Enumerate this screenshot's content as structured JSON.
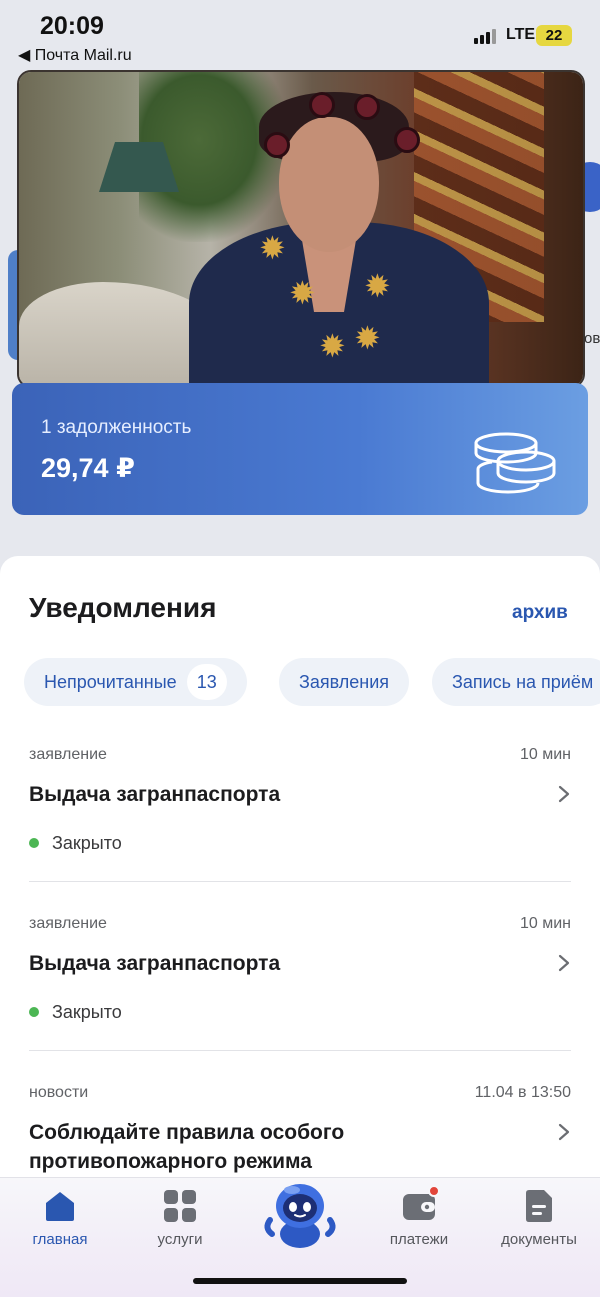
{
  "status_bar": {
    "time": "20:09",
    "back_label": "◀ Почта Mail.ru",
    "network": "LTE",
    "battery": "22"
  },
  "background": {
    "partial_text": "ов"
  },
  "debt_card": {
    "label": "1 задолженность",
    "amount": "29,74 ₽",
    "icon": "coins-icon"
  },
  "notifications": {
    "title": "Уведомления",
    "archive_label": "архив",
    "filters": [
      {
        "label": "Непрочитанные",
        "count": "13"
      },
      {
        "label": "Заявления"
      },
      {
        "label": "Запись на приём"
      }
    ],
    "items": [
      {
        "category": "заявление",
        "time": "10 мин",
        "title": "Выдача загранпаспорта",
        "status": "Закрыто"
      },
      {
        "category": "заявление",
        "time": "10 мин",
        "title": "Выдача загранпаспорта",
        "status": "Закрыто"
      },
      {
        "category": "новости",
        "time": "11.04 в 13:50",
        "title": "Соблюдайте правила особого противопожарного режима"
      }
    ]
  },
  "tabbar": {
    "items": [
      {
        "label": "главная",
        "icon": "home-icon",
        "active": true
      },
      {
        "label": "услуги",
        "icon": "grid-icon"
      },
      {
        "label": "",
        "icon": "robot-assistant-icon"
      },
      {
        "label": "платежи",
        "icon": "wallet-icon"
      },
      {
        "label": "документы",
        "icon": "document-icon"
      }
    ]
  },
  "colors": {
    "accent": "#2a57b0",
    "debt_card": "#4a7ad2",
    "status_closed": "#4cb654",
    "notification_dot": "#e2453a"
  }
}
